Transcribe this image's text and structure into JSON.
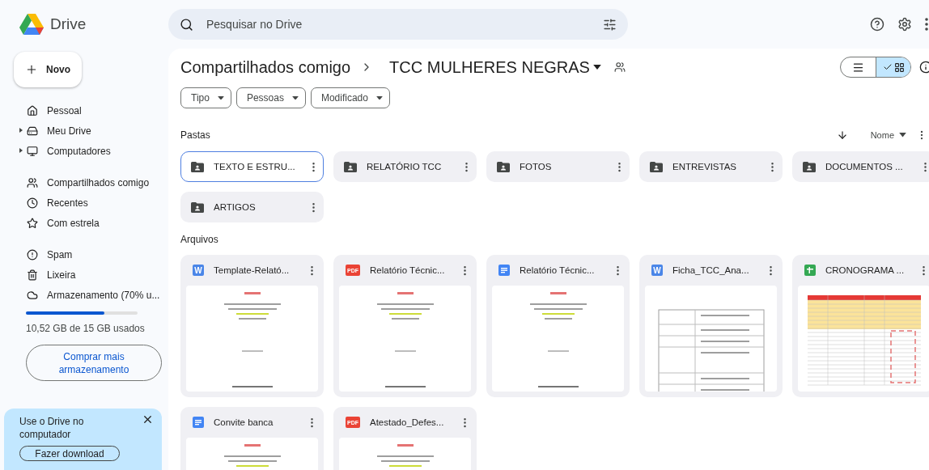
{
  "app": {
    "name": "Drive"
  },
  "sidebar": {
    "new_button": "Novo",
    "groups": [
      [
        {
          "label": "Pessoal",
          "has_children": false
        },
        {
          "label": "Meu Drive",
          "has_children": true
        },
        {
          "label": "Computadores",
          "has_children": true
        }
      ],
      [
        {
          "label": "Compartilhados comigo",
          "has_children": false
        },
        {
          "label": "Recentes",
          "has_children": false
        },
        {
          "label": "Com estrela",
          "has_children": false
        }
      ],
      [
        {
          "label": "Spam",
          "has_children": false
        },
        {
          "label": "Lixeira",
          "has_children": false
        },
        {
          "label": "Armazenamento (70% u...",
          "has_children": false
        }
      ]
    ],
    "storage": {
      "level": 0.7,
      "used": "10,52 GB de 15 GB usados",
      "button": "Comprar mais armazenamento"
    },
    "promo": {
      "text": "Use o Drive no computador",
      "button": "Fazer download"
    }
  },
  "search": {
    "placeholder": "Pesquisar no Drive"
  },
  "breadcrumb": [
    "Compartilhados comigo",
    "TCC MULHERES NEGRAS"
  ],
  "filters": [
    "Tipo",
    "Pessoas",
    "Modificado"
  ],
  "view_toggle": [
    {
      "kind": "list",
      "selected": false
    },
    {
      "kind": "grid",
      "selected": true
    }
  ],
  "folders": {
    "title": "Pastas",
    "sort": "Nome",
    "items": [
      {
        "name": "TEXTO E ESTRU...",
        "selected": true
      },
      {
        "name": "RELATÓRIO TCC",
        "selected": false
      },
      {
        "name": "FOTOS",
        "selected": false
      },
      {
        "name": "ENTREVISTAS",
        "selected": false
      },
      {
        "name": "DOCUMENTOS ...",
        "selected": false
      },
      {
        "name": "ARTIGOS",
        "selected": false
      }
    ]
  },
  "files": {
    "title": "Arquivos",
    "items": [
      {
        "name": "Template-Relató...",
        "kind": "badge",
        "badge": "W"
      },
      {
        "name": "Relatório Técnic...",
        "kind": "badge",
        "badge": "PDF"
      },
      {
        "name": "Relatório Técnic...",
        "kind": "docs"
      },
      {
        "name": "Ficha_TCC_Ana...",
        "kind": "badge",
        "badge": "W"
      },
      {
        "name": "CRONOGRAMA ...",
        "kind": "sheets"
      },
      {
        "name": "Convite banca",
        "kind": "docs"
      },
      {
        "name": "Atestado_Defes...",
        "kind": "badge",
        "badge": "PDF"
      }
    ]
  }
}
